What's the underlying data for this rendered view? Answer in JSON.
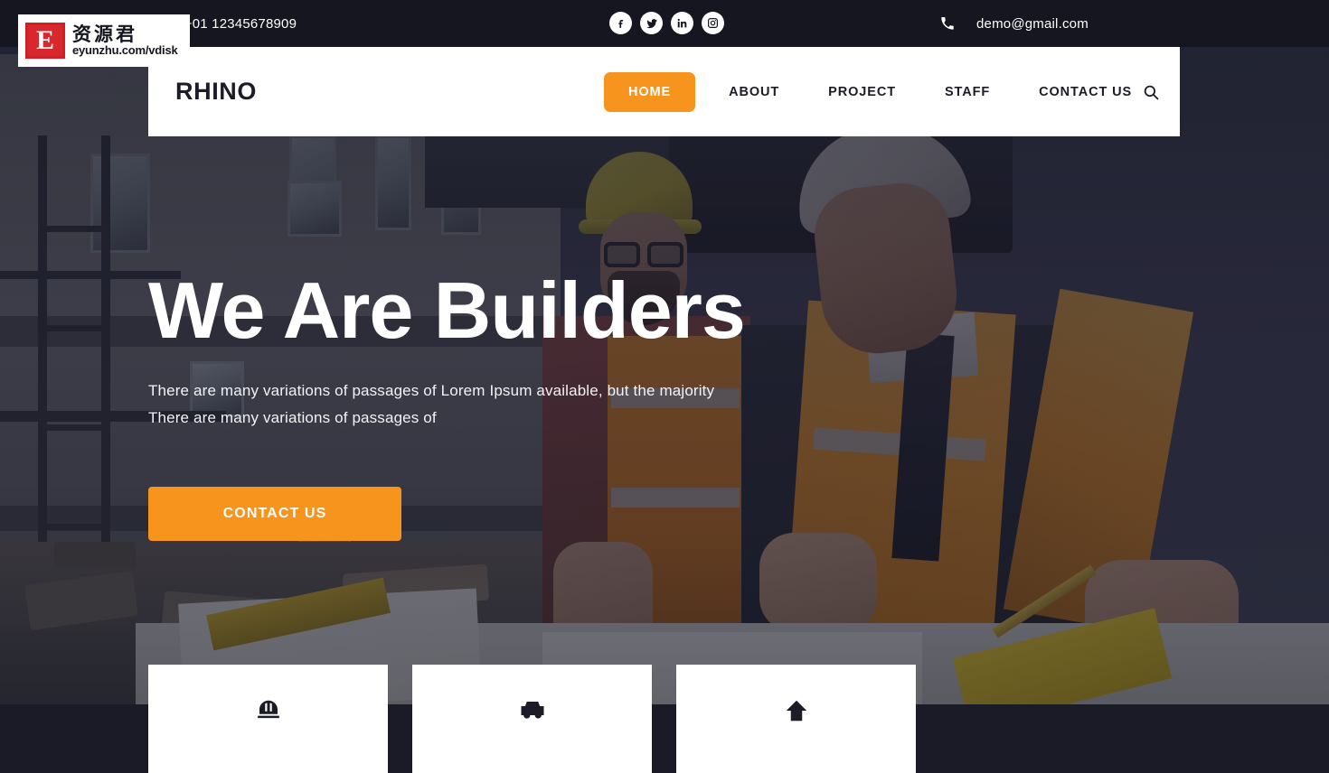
{
  "topbar": {
    "call_text": "Call : +01 12345678909",
    "email_text": "demo@gmail.com",
    "phone_icon": "phone-icon",
    "social": [
      {
        "name": "facebook-icon",
        "label": "Facebook"
      },
      {
        "name": "twitter-icon",
        "label": "Twitter"
      },
      {
        "name": "linkedin-icon",
        "label": "LinkedIn"
      },
      {
        "name": "instagram-icon",
        "label": "Instagram"
      }
    ],
    "bg_color": "#15161f"
  },
  "navbar": {
    "brand": "RHINO",
    "search_icon": "search-icon",
    "active_color": "#f7941e",
    "items": [
      {
        "label": "HOME",
        "active": true
      },
      {
        "label": "ABOUT",
        "active": false
      },
      {
        "label": "PROJECT",
        "active": false
      },
      {
        "label": "STAFF",
        "active": false
      },
      {
        "label": "CONTACT US",
        "active": false
      }
    ]
  },
  "hero": {
    "title": "We Are Builders",
    "subtitle_line1": "There are many variations of passages of Lorem Ipsum available, but the majority",
    "subtitle_line2": "There are many variations of passages of",
    "cta_label": "CONTACT US",
    "cta_color": "#f7941e"
  },
  "cards": [
    {
      "icon": "helmet-icon"
    },
    {
      "icon": "truck-icon"
    },
    {
      "icon": "crane-icon"
    }
  ],
  "watermark": {
    "letter": "E",
    "chinese": "资源君",
    "url": "eyunzhu.com/vdisk"
  }
}
